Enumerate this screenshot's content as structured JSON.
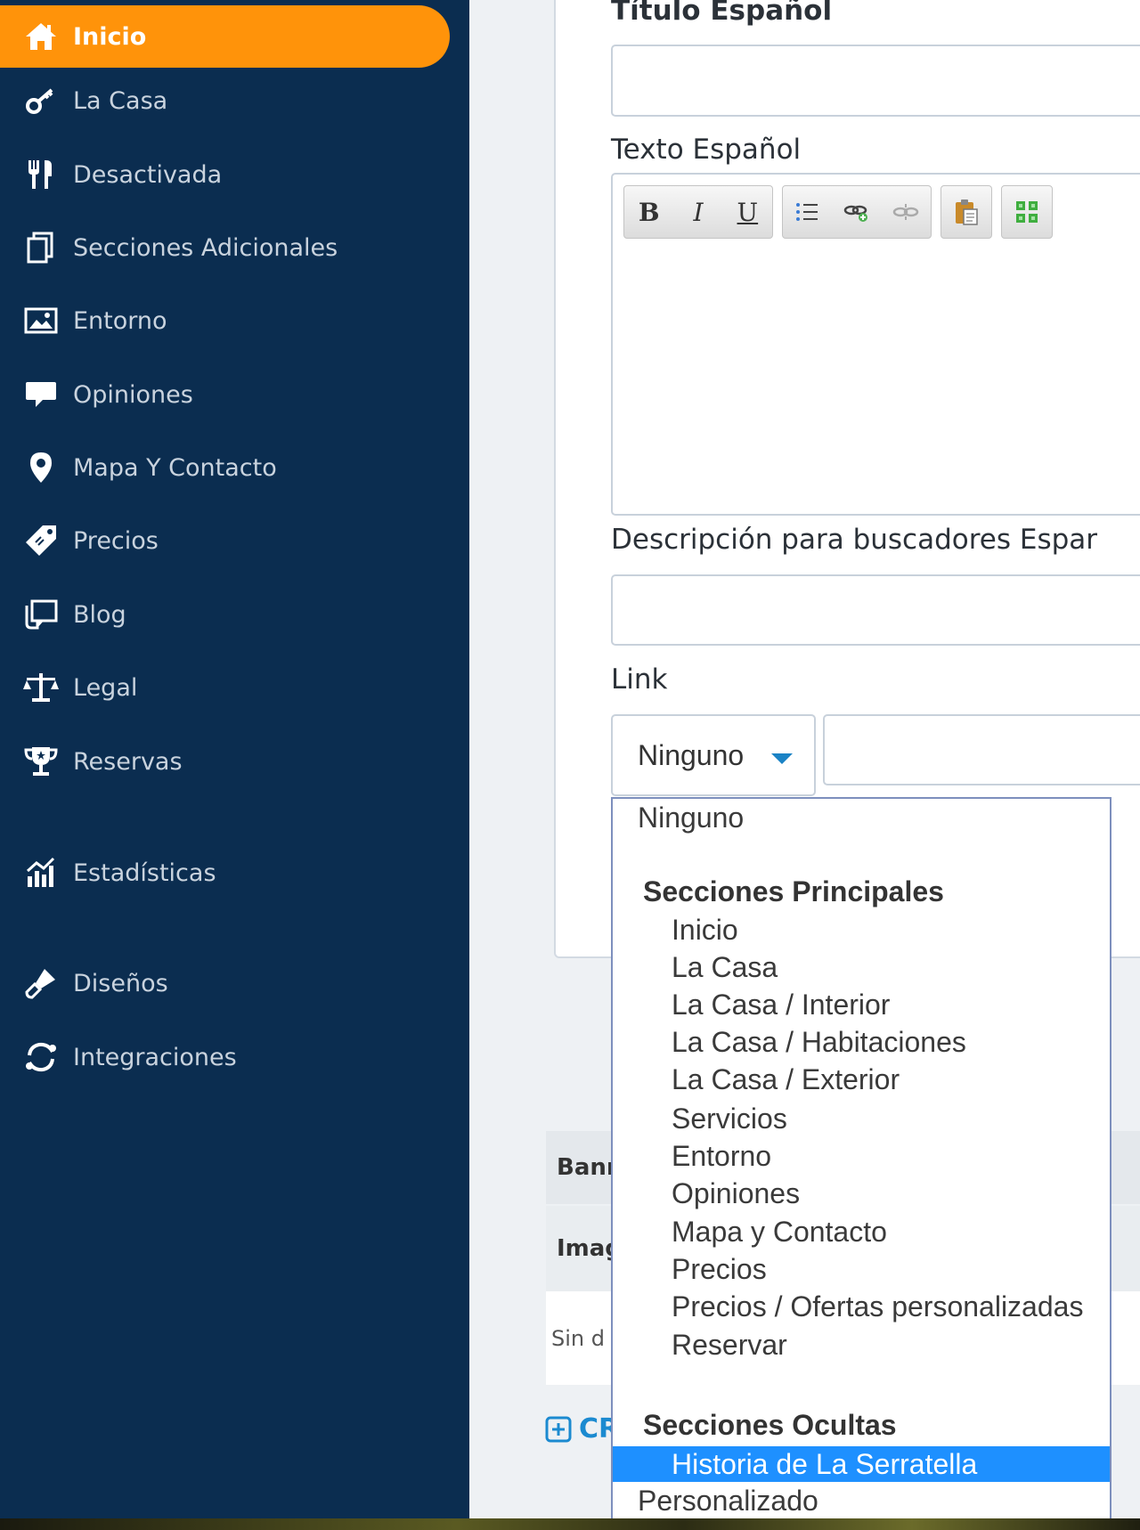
{
  "sidebar": {
    "items": [
      {
        "label": "Inicio",
        "icon": "home-icon",
        "active": true
      },
      {
        "label": "La Casa",
        "icon": "key-icon"
      },
      {
        "label": "Desactivada",
        "icon": "utensils-icon"
      },
      {
        "label": "Secciones Adicionales",
        "icon": "copy-icon"
      },
      {
        "label": "Entorno",
        "icon": "image-icon"
      },
      {
        "label": "Opiniones",
        "icon": "comment-icon"
      },
      {
        "label": "Mapa Y Contacto",
        "icon": "map-marker-icon"
      },
      {
        "label": "Precios",
        "icon": "price-tag-icon"
      },
      {
        "label": "Blog",
        "icon": "blog-icon"
      },
      {
        "label": "Legal",
        "icon": "scale-icon"
      },
      {
        "label": "Reservas",
        "icon": "trophy-icon"
      },
      {
        "label": "Estadísticas",
        "icon": "stats-icon"
      },
      {
        "label": "Diseños",
        "icon": "brush-icon"
      },
      {
        "label": "Integraciones",
        "icon": "sync-icon"
      }
    ],
    "active_color": "#ff930a",
    "background_color": "#0b2d50"
  },
  "form": {
    "title_label": "Título Español",
    "text_label": "Texto Español",
    "seo_label": "Descripción para buscadores Espar",
    "link_label": "Link",
    "link_select_value": "Ninguno",
    "title_value": "",
    "seo_value": "",
    "link_url_value": ""
  },
  "editor_toolbar": {
    "bold": "B",
    "italic": "I",
    "underline": "U",
    "buttons": [
      "bold-icon",
      "italic-icon",
      "underline-icon",
      "list-icon",
      "link-icon",
      "unlink-icon",
      "paste-icon",
      "blocks-icon"
    ]
  },
  "banner_table": {
    "header": "Banr",
    "subheader": "Imag",
    "empty_text": "Sin d",
    "create_label": "CR"
  },
  "dropdown": {
    "options": [
      {
        "label": "Ninguno",
        "type": "top"
      },
      {
        "label": "Secciones Principales",
        "type": "group"
      },
      {
        "label": "Inicio",
        "type": "child"
      },
      {
        "label": "La Casa",
        "type": "child"
      },
      {
        "label": "La Casa / Interior",
        "type": "child"
      },
      {
        "label": "La Casa / Habitaciones",
        "type": "child"
      },
      {
        "label": "La Casa / Exterior",
        "type": "child"
      },
      {
        "label": "Servicios",
        "type": "child"
      },
      {
        "label": "Entorno",
        "type": "child"
      },
      {
        "label": "Opiniones",
        "type": "child"
      },
      {
        "label": "Mapa y Contacto",
        "type": "child"
      },
      {
        "label": "Precios",
        "type": "child"
      },
      {
        "label": "Precios / Ofertas personalizadas",
        "type": "child"
      },
      {
        "label": "Reservar",
        "type": "child"
      },
      {
        "label": "Secciones Ocultas",
        "type": "group"
      },
      {
        "label": "Historia de La Serratella",
        "type": "child",
        "selected": true
      },
      {
        "label": "Personalizado",
        "type": "top"
      }
    ],
    "selected_color": "#1e90ff"
  }
}
